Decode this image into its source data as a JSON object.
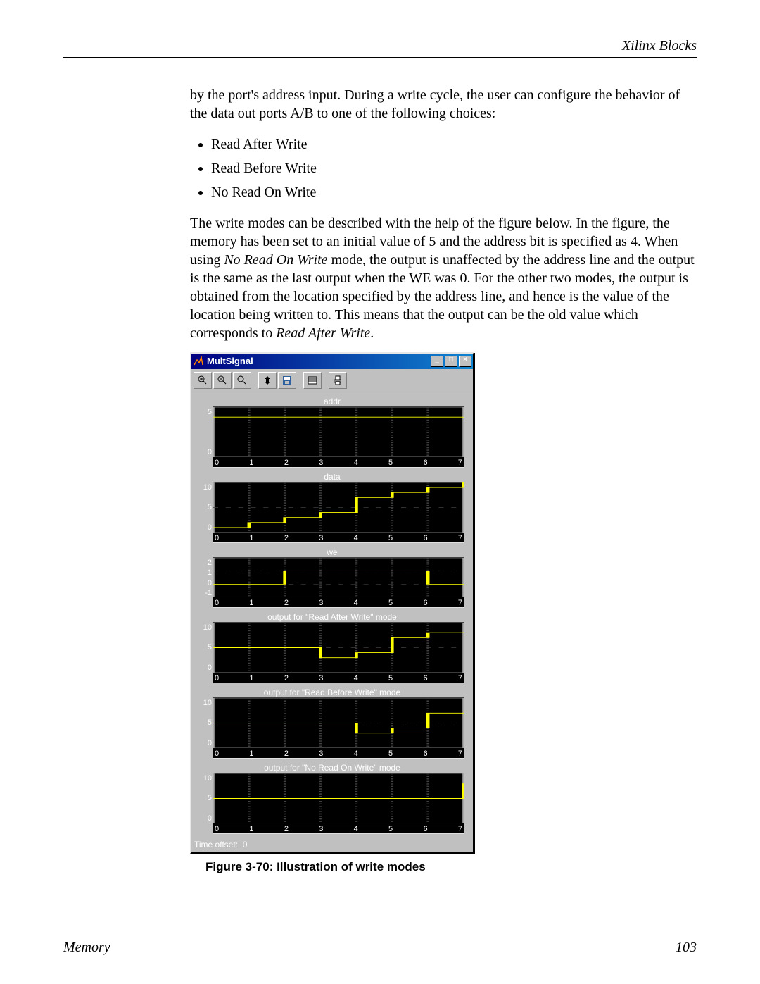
{
  "header": {
    "right": "Xilinx Blocks"
  },
  "para1": "by the port's address input. During a write cycle, the user can configure the behavior of the data out ports A/B to one of the following choices:",
  "bullets": [
    "Read After Write",
    "Read Before Write",
    "No Read On Write"
  ],
  "para2_pre": "The write modes can be described with the help of the figure below. In the figure, the memory has been set to an initial value of 5 and the address bit is specified as 4. When using ",
  "para2_em1": "No Read On Write",
  "para2_mid": " mode, the output is unaffected by the address line and the output is the same as the last output when the WE was 0. For the other two modes, the output is obtained from the location specified by the address line, and hence is the value of the location being written to. This means that the output can be the old value which corresponds to ",
  "para2_em2": "Read After Write",
  "para2_end": ".",
  "multisignal": {
    "title": "MultSignal",
    "time_offset_label": "Time offset:",
    "time_offset_value": "0",
    "toolbar_icons": [
      "zoom-in-icon",
      "zoom-out-icon",
      "zoom-xy-icon",
      "autoscale-icon",
      "save-icon",
      "params-icon",
      "print-icon"
    ],
    "plots": [
      {
        "title": "addr",
        "y": [
          "5",
          "0"
        ],
        "x": [
          "0",
          "1",
          "2",
          "3",
          "4",
          "5",
          "6",
          "7"
        ],
        "small": false
      },
      {
        "title": "data",
        "y": [
          "10",
          "5",
          "0"
        ],
        "x": [
          "0",
          "1",
          "2",
          "3",
          "4",
          "5",
          "6",
          "7"
        ],
        "small": false
      },
      {
        "title": "we",
        "y": [
          "2",
          "1",
          "0",
          "-1"
        ],
        "x": [
          "0",
          "1",
          "2",
          "3",
          "4",
          "5",
          "6",
          "7"
        ],
        "small": true
      },
      {
        "title": "output for \"Read After Write\" mode",
        "y": [
          "10",
          "5",
          "0"
        ],
        "x": [
          "0",
          "1",
          "2",
          "3",
          "4",
          "5",
          "6",
          "7"
        ],
        "small": false
      },
      {
        "title": "output for \"Read Before Write\" mode",
        "y": [
          "10",
          "5",
          "0"
        ],
        "x": [
          "0",
          "1",
          "2",
          "3",
          "4",
          "5",
          "6",
          "7"
        ],
        "small": false
      },
      {
        "title": "output for \"No Read On Write\" mode",
        "y": [
          "10",
          "5",
          "0"
        ],
        "x": [
          "0",
          "1",
          "2",
          "3",
          "4",
          "5",
          "6",
          "7"
        ],
        "small": false
      }
    ]
  },
  "chart_data": [
    {
      "type": "line",
      "title": "addr",
      "xlabel": "",
      "ylabel": "",
      "xlim": [
        0,
        7
      ],
      "ylim": [
        0,
        5
      ],
      "x": [
        0,
        1,
        2,
        3,
        4,
        5,
        6,
        7
      ],
      "values": [
        4,
        4,
        4,
        4,
        4,
        4,
        4,
        4
      ]
    },
    {
      "type": "line",
      "title": "data",
      "xlabel": "",
      "ylabel": "",
      "xlim": [
        0,
        7
      ],
      "ylim": [
        0,
        10
      ],
      "x": [
        0,
        1,
        2,
        3,
        4,
        5,
        6,
        7
      ],
      "values": [
        1,
        2,
        3,
        4,
        7,
        8,
        9,
        10
      ]
    },
    {
      "type": "line",
      "title": "we",
      "xlabel": "",
      "ylabel": "",
      "xlim": [
        0,
        7
      ],
      "ylim": [
        -1,
        2
      ],
      "x": [
        0,
        1,
        2,
        3,
        4,
        5,
        6,
        7
      ],
      "values": [
        0,
        0,
        1,
        1,
        1,
        1,
        0,
        0
      ]
    },
    {
      "type": "line",
      "title": "output for \"Read After Write\" mode",
      "xlabel": "",
      "ylabel": "",
      "xlim": [
        0,
        7
      ],
      "ylim": [
        0,
        10
      ],
      "x": [
        0,
        1,
        2,
        3,
        4,
        5,
        6,
        7
      ],
      "values": [
        5,
        5,
        5,
        3,
        4,
        7,
        8,
        8
      ]
    },
    {
      "type": "line",
      "title": "output for \"Read Before Write\" mode",
      "xlabel": "",
      "ylabel": "",
      "xlim": [
        0,
        7
      ],
      "ylim": [
        0,
        10
      ],
      "x": [
        0,
        1,
        2,
        3,
        4,
        5,
        6,
        7
      ],
      "values": [
        5,
        5,
        5,
        5,
        3,
        4,
        7,
        7
      ]
    },
    {
      "type": "line",
      "title": "output for \"No Read On Write\" mode",
      "xlabel": "",
      "ylabel": "",
      "xlim": [
        0,
        7
      ],
      "ylim": [
        0,
        10
      ],
      "x": [
        0,
        1,
        2,
        3,
        4,
        5,
        6,
        7
      ],
      "values": [
        5,
        5,
        5,
        5,
        5,
        5,
        5,
        8
      ]
    }
  ],
  "caption_strong": "Figure 3-70:",
  "caption_rest": "   Illustration of write modes",
  "footer": {
    "left": "Memory",
    "right": "103"
  }
}
